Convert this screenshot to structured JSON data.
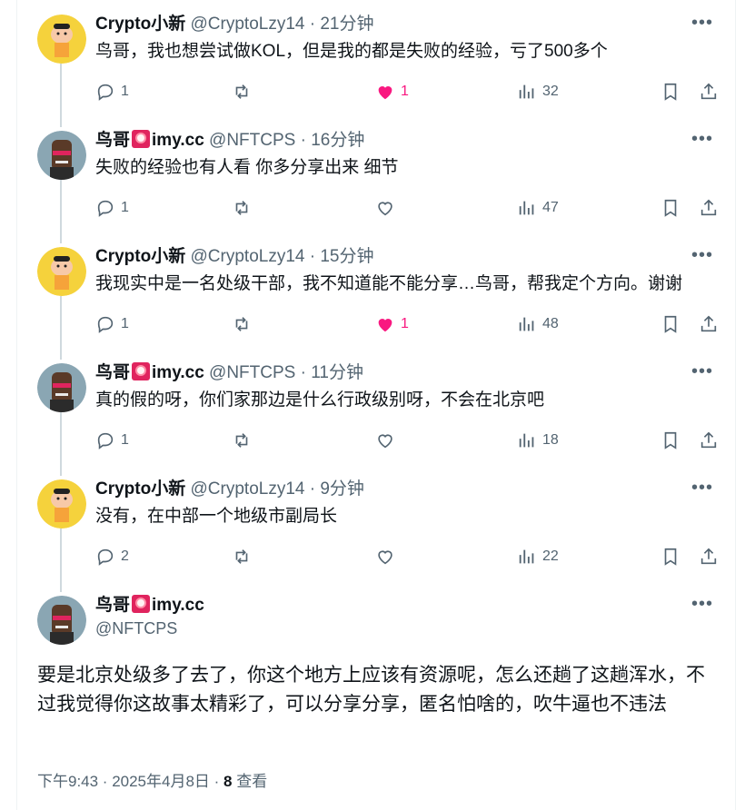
{
  "replies": [
    {
      "name": "Crypto小新",
      "handle": "@CryptoLzy14",
      "time": "21分钟",
      "text": "鸟哥，我也想尝试做KOL，但是我的都是失败的经验，亏了500多个",
      "replies": "1",
      "reposts": "",
      "likes": "1",
      "liked": true,
      "views": "32",
      "avatar": "crayon-avatar"
    },
    {
      "name": "鸟哥",
      "name_suffix": "imy.cc",
      "handle": "@NFTCPS",
      "time": "16分钟",
      "text": "失败的经验也有人看 你多分享出来  细节",
      "replies": "1",
      "reposts": "",
      "likes": "",
      "liked": false,
      "views": "47",
      "avatar": "pixel-avatar"
    },
    {
      "name": "Crypto小新",
      "handle": "@CryptoLzy14",
      "time": "15分钟",
      "text": "我现实中是一名处级干部，我不知道能不能分享…鸟哥，帮我定个方向。谢谢",
      "replies": "1",
      "reposts": "",
      "likes": "1",
      "liked": true,
      "views": "48",
      "avatar": "crayon-avatar"
    },
    {
      "name": "鸟哥",
      "name_suffix": "imy.cc",
      "handle": "@NFTCPS",
      "time": "11分钟",
      "text": "真的假的呀，你们家那边是什么行政级别呀，不会在北京吧",
      "replies": "1",
      "reposts": "",
      "likes": "",
      "liked": false,
      "views": "18",
      "avatar": "pixel-avatar"
    },
    {
      "name": "Crypto小新",
      "handle": "@CryptoLzy14",
      "time": "9分钟",
      "text": "没有，在中部一个地级市副局长",
      "replies": "2",
      "reposts": "",
      "likes": "",
      "liked": false,
      "views": "22",
      "avatar": "crayon-avatar"
    }
  ],
  "separator": "·",
  "main": {
    "name": "鸟哥",
    "name_suffix": "imy.cc",
    "handle": "@NFTCPS",
    "text": "要是北京处级多了去了，你这个地方上应该有资源呢，怎么还趟了这趟浑水，不过我觉得你这故事太精彩了，可以分享分享，匿名怕啥的，吹牛逼也不违法",
    "timestamp": "下午9:43 · 2025年4月8日 · ",
    "views_count": "8",
    "views_label": " 查看"
  },
  "colors": {
    "like": "#f91880",
    "muted": "#536471",
    "line": "#cfd9de"
  }
}
